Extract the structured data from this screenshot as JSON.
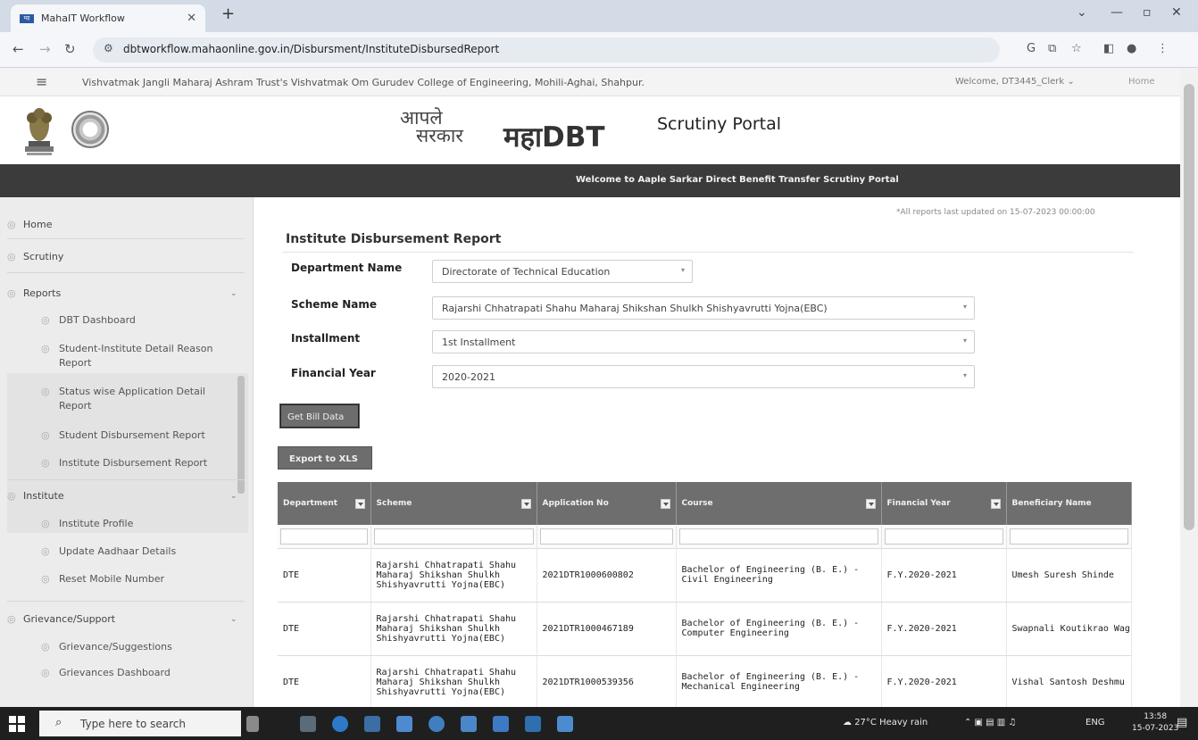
{
  "browser": {
    "tab_title": "MahaIT Workflow",
    "url": "dbtworkflow.mahaonline.gov.in/Disbursment/InstituteDisbursedReport"
  },
  "header": {
    "college_name": "Vishvatmak Jangli Maharaj Ashram Trust's Vishvatmak Om Gurudev College of Engineering, Mohili-Aghai, Shahpur.",
    "welcome": "Welcome, DT3445_Clerk",
    "home": "Home",
    "logo_aaple_1": "आपले",
    "logo_aaple_2": "सरकार",
    "logo_maha": "महाDBT",
    "portal_name": "Scrutiny Portal",
    "banner": "Welcome to Aaple Sarkar Direct Benefit Transfer Scrutiny Portal",
    "last_updated": "*All reports last updated on 15-07-2023 00:00:00"
  },
  "sidebar": {
    "home": "Home",
    "scrutiny": "Scrutiny",
    "reports": "Reports",
    "report_items": [
      "DBT Dashboard",
      "Student-Institute Detail Reason Report",
      "Status wise Application Detail Report",
      "Student Disbursement Report",
      "Institute Disbursement Report"
    ],
    "institute": "Institute",
    "institute_items": [
      "Institute Profile",
      "Update Aadhaar Details",
      "Reset Mobile Number"
    ],
    "grievance": "Grievance/Support",
    "grievance_items": [
      "Grievance/Suggestions",
      "Grievances Dashboard"
    ]
  },
  "main": {
    "title": "Institute Disbursement Report",
    "fields": {
      "department_label": "Department Name",
      "department_value": "Directorate of Technical Education",
      "scheme_label": "Scheme Name",
      "scheme_value": "Rajarshi Chhatrapati Shahu Maharaj Shikshan Shulkh Shishyavrutti Yojna(EBC)",
      "installment_label": "Installment",
      "installment_value": "1st Installment",
      "fy_label": "Financial Year",
      "fy_value": "2020-2021"
    },
    "get_bill_button": "Get Bill Data",
    "export_button": "Export to XLS"
  },
  "table": {
    "columns": [
      "Department",
      "Scheme",
      "Application No",
      "Course",
      "Financial Year",
      "Beneficiary Name"
    ],
    "rows": [
      [
        "DTE",
        "Rajarshi Chhatrapati Shahu Maharaj Shikshan Shulkh Shishyavrutti Yojna(EBC)",
        "2021DTR1000600802",
        "Bachelor of Engineering (B. E.) - Civil Engineering",
        "F.Y.2020-2021",
        "Umesh Suresh Shinde"
      ],
      [
        "DTE",
        "Rajarshi Chhatrapati Shahu Maharaj Shikshan Shulkh Shishyavrutti Yojna(EBC)",
        "2021DTR1000467189",
        "Bachelor of Engineering (B. E.) - Computer Engineering",
        "F.Y.2020-2021",
        "Swapnali Koutikrao Wag"
      ],
      [
        "DTE",
        "Rajarshi Chhatrapati Shahu Maharaj Shikshan Shulkh Shishyavrutti Yojna(EBC)",
        "2021DTR1000539356",
        "Bachelor of Engineering (B. E.) - Mechanical Engineering",
        "F.Y.2020-2021",
        "Vishal Santosh Deshmu"
      ]
    ]
  },
  "taskbar": {
    "search_placeholder": "Type here to search",
    "weather": "27°C  Heavy rain",
    "lang": "ENG",
    "time": "13:58",
    "date": "15-07-2023"
  },
  "colors": {
    "header_bar": "#3b3b3b",
    "table_header": "#6e6e6e",
    "button": "#6d6d6d"
  }
}
